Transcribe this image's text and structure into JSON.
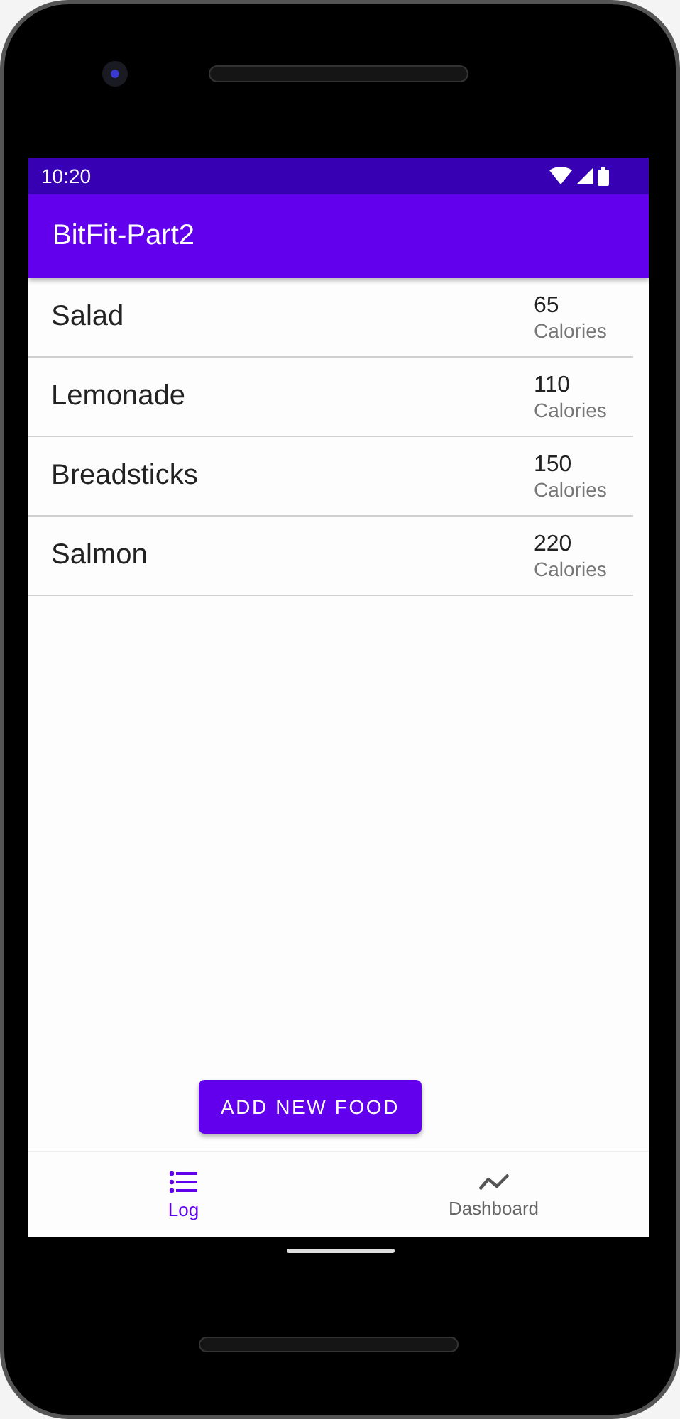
{
  "status_bar": {
    "time": "10:20"
  },
  "app_bar": {
    "title": "BitFit-Part2"
  },
  "foods": [
    {
      "name": "Salad",
      "calories": "65",
      "unit": "Calories"
    },
    {
      "name": "Lemonade",
      "calories": "110",
      "unit": "Calories"
    },
    {
      "name": "Breadsticks",
      "calories": "150",
      "unit": "Calories"
    },
    {
      "name": "Salmon",
      "calories": "220",
      "unit": "Calories"
    }
  ],
  "add_button": {
    "label": "ADD NEW FOOD"
  },
  "bottom_nav": [
    {
      "label": "Log",
      "kind": "list",
      "selected": true
    },
    {
      "label": "Dashboard",
      "kind": "chart",
      "selected": false
    }
  ]
}
